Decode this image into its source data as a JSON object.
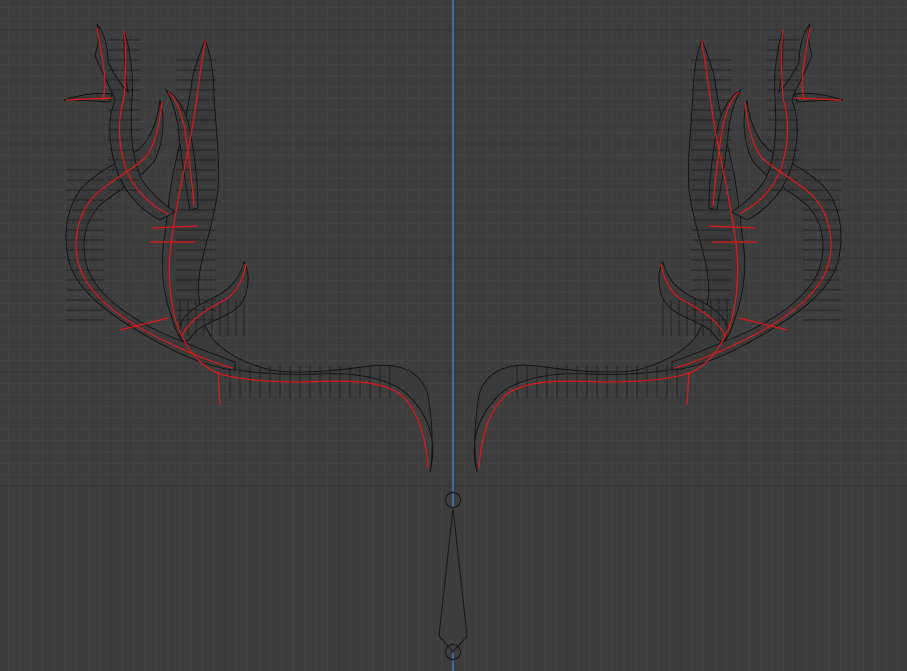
{
  "viewport": {
    "background_color": "#3d3d3d",
    "grid_color": "#353535",
    "subgrid_color": "#444444",
    "axis_color": "#4a7fd0",
    "mesh_wire_color": "#111111",
    "seam_color": "#e01818"
  },
  "scene": {
    "objects": [
      "antlers-mesh",
      "armature-bone"
    ],
    "mirror": true
  }
}
